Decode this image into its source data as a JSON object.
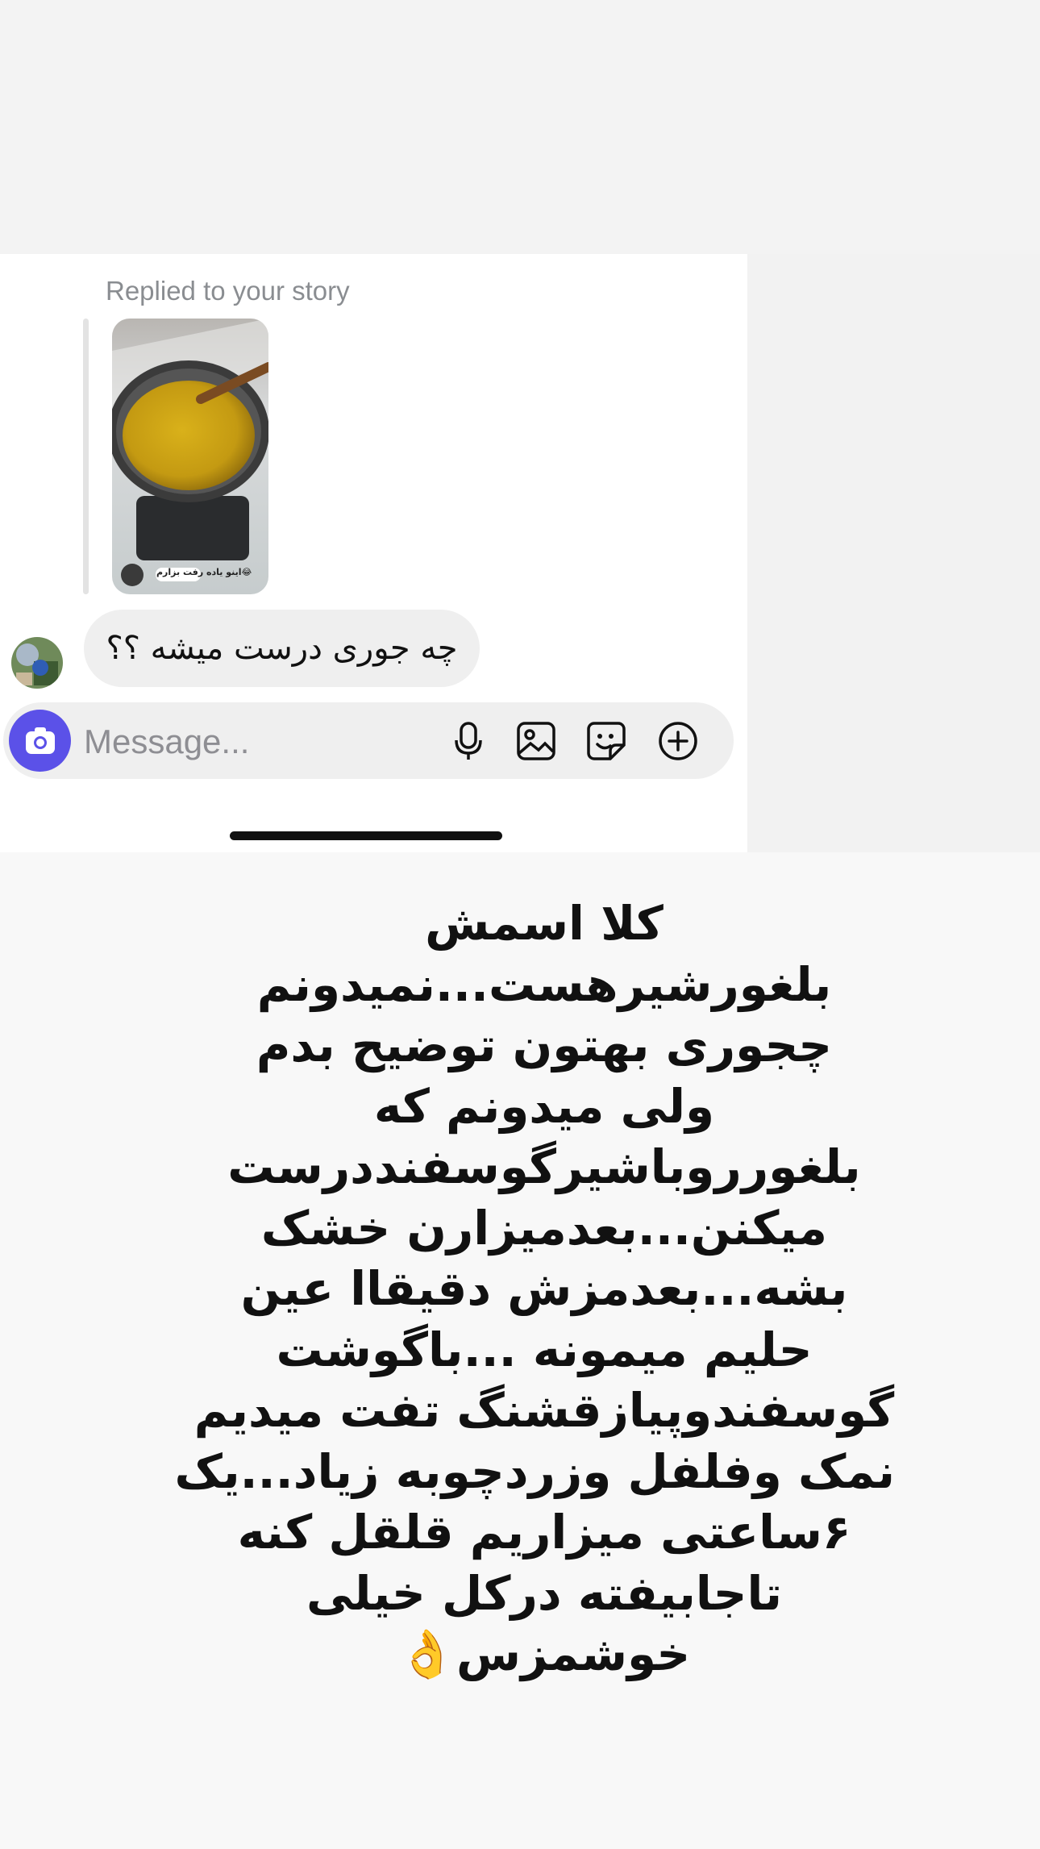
{
  "colors": {
    "camera_button": "#5b51e8",
    "bubble": "#efefef",
    "panel": "#ffffff",
    "secondary_text": "#8a8d91"
  },
  "story_reply": {
    "label": "Replied to your story",
    "thumbnail_caption": "اینو یاده رفت بزارم😂"
  },
  "message": {
    "text": "چه جوری درست میشه ؟؟"
  },
  "composer": {
    "placeholder": "Message...",
    "icons": [
      "camera-icon",
      "microphone-icon",
      "gallery-icon",
      "sticker-icon",
      "plus-icon"
    ]
  },
  "overlay": {
    "lines": [
      "کلا اسمش",
      "بلغورشیرهست...نمیدونم",
      "چجوری بهتون توضیح بدم",
      "ولی میدونم که",
      "بلغورروباشیرگوسفنددرست",
      "میکنن...بعدمیزارن خشک",
      "بشه...بعدمزش دقیقاا عین",
      "حلیم میمونه ...باگوشت",
      "گوسفندوپیازقشنگ تفت میدیم",
      "نمک وفلفل وزردچوبه زیاد...یک",
      "۶ساعتی میزاریم قلقل کنه",
      "تاجابیفته درکل خیلی",
      "خوشمزس👌"
    ]
  }
}
